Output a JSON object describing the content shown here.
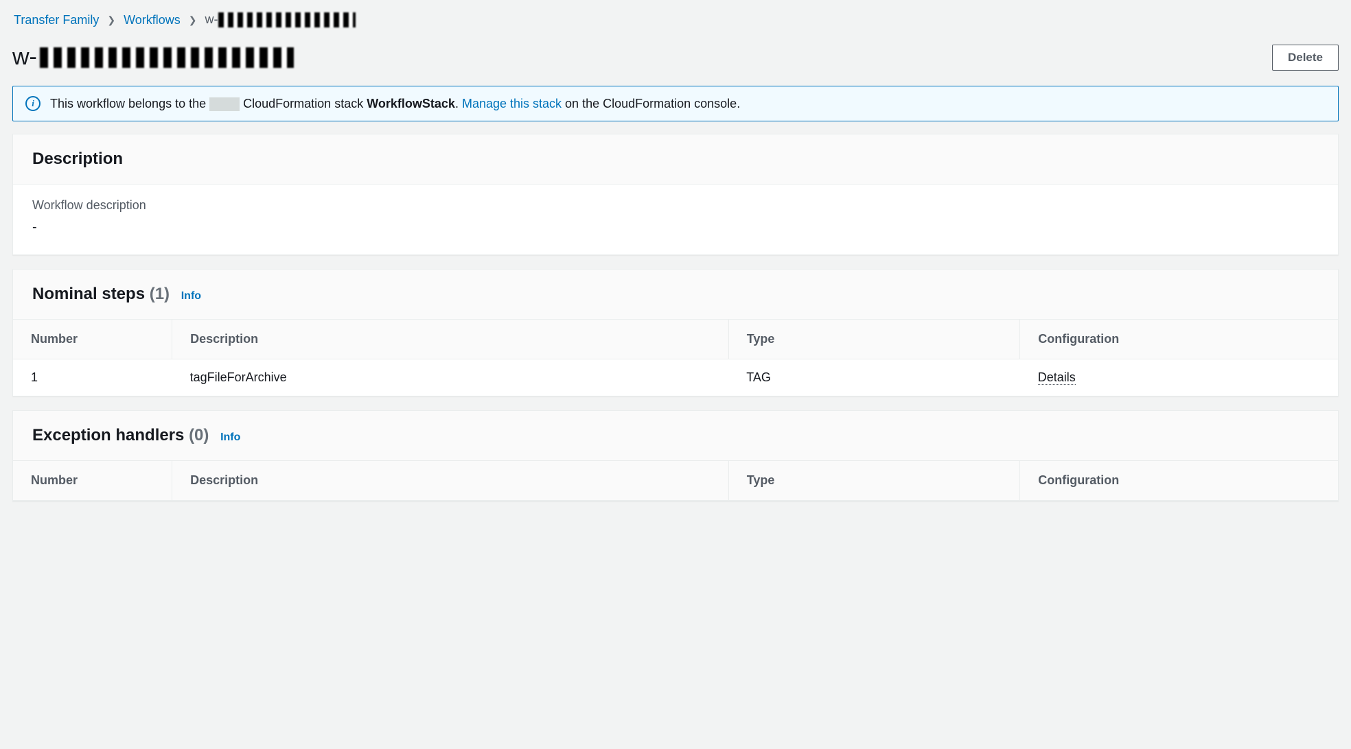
{
  "breadcrumb": {
    "root": "Transfer Family",
    "parent": "Workflows",
    "current_prefix": "w-"
  },
  "title_prefix": "w-",
  "delete_label": "Delete",
  "info_banner": {
    "before": "This workflow belongs to the",
    "middle": "CloudFormation stack",
    "stack_name": "WorkflowStack",
    "manage_link": "Manage this stack",
    "after": "on the CloudFormation console."
  },
  "description_panel": {
    "title": "Description",
    "field_label": "Workflow description",
    "value": "-"
  },
  "nominal": {
    "title": "Nominal steps",
    "count": "(1)",
    "info": "Info",
    "columns": {
      "number": "Number",
      "description": "Description",
      "type": "Type",
      "configuration": "Configuration"
    },
    "rows": [
      {
        "number": "1",
        "description": "tagFileForArchive",
        "type": "TAG",
        "configuration": "Details"
      }
    ]
  },
  "exception": {
    "title": "Exception handlers",
    "count": "(0)",
    "info": "Info",
    "columns": {
      "number": "Number",
      "description": "Description",
      "type": "Type",
      "configuration": "Configuration"
    }
  }
}
